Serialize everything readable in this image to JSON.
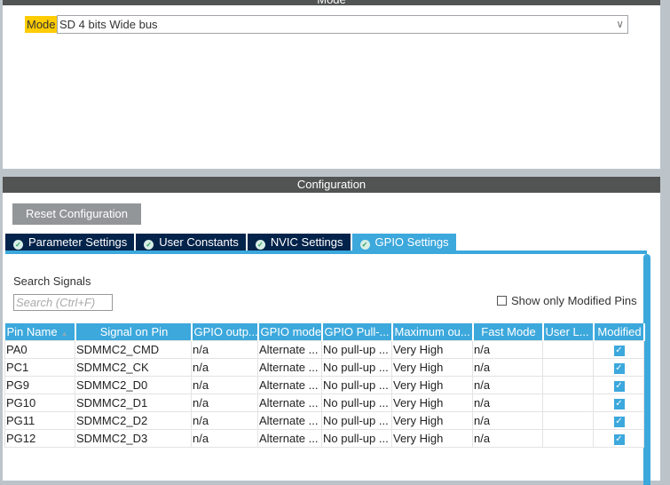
{
  "mode_panel": {
    "title": "Mode",
    "mode_label": "Mode",
    "mode_value": "SD 4 bits Wide bus"
  },
  "config_panel": {
    "title": "Configuration",
    "reset_label": "Reset Configuration",
    "tabs": [
      {
        "label": "Parameter Settings"
      },
      {
        "label": "User Constants"
      },
      {
        "label": "NVIC Settings"
      },
      {
        "label": "GPIO Settings"
      }
    ],
    "search_label": "Search Signals",
    "search_placeholder": "Search (Ctrl+F)",
    "show_modified_label": "Show only Modified Pins",
    "columns": [
      "Pin Name",
      "Signal on Pin",
      "GPIO outp...",
      "GPIO mode",
      "GPIO Pull-...",
      "Maximum ou...",
      "Fast Mode",
      "User L...",
      "Modified"
    ],
    "rows": [
      [
        "PA0",
        "SDMMC2_CMD",
        "n/a",
        "Alternate ...",
        "No pull-up ...",
        "Very High",
        "n/a",
        "",
        true
      ],
      [
        "PC1",
        "SDMMC2_CK",
        "n/a",
        "Alternate ...",
        "No pull-up ...",
        "Very High",
        "n/a",
        "",
        true
      ],
      [
        "PG9",
        "SDMMC2_D0",
        "n/a",
        "Alternate ...",
        "No pull-up ...",
        "Very High",
        "n/a",
        "",
        true
      ],
      [
        "PG10",
        "SDMMC2_D1",
        "n/a",
        "Alternate ...",
        "No pull-up ...",
        "Very High",
        "n/a",
        "",
        true
      ],
      [
        "PG11",
        "SDMMC2_D2",
        "n/a",
        "Alternate ...",
        "No pull-up ...",
        "Very High",
        "n/a",
        "",
        true
      ],
      [
        "PG12",
        "SDMMC2_D3",
        "n/a",
        "Alternate ...",
        "No pull-up ...",
        "Very High",
        "n/a",
        "",
        true
      ]
    ]
  }
}
